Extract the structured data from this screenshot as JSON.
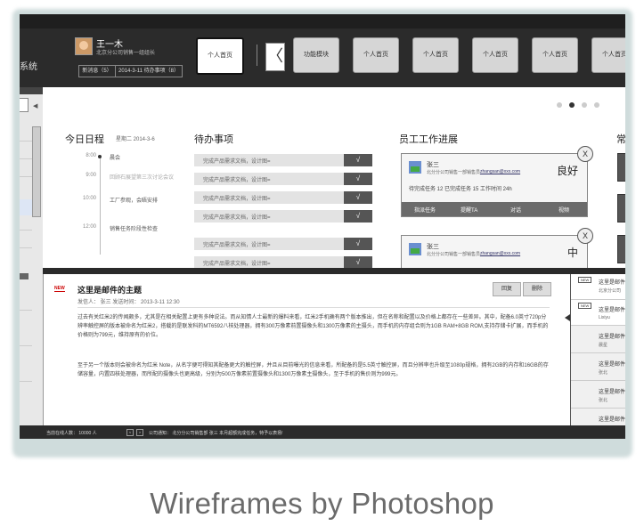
{
  "header": {
    "app_title": "系统",
    "user_name": "王一木",
    "user_dept": "北京分公司销售一组组长",
    "pill_news": "新消息（5）",
    "pill_todo": "2014-3-11 待办事项（8）",
    "tabs": [
      "个人首页",
      "功能模块",
      "个人首页",
      "个人首页",
      "个人首页",
      "个人首页",
      "个人首页"
    ],
    "back_glyph": "〈"
  },
  "dashboard": {
    "schedule_title": "今日日程",
    "schedule_weekday": "星期二  2014-3-6",
    "schedule": [
      {
        "time": "8:00",
        "text": "晨会"
      },
      {
        "time": "9:00",
        "text": "回顾石展望第三次讨论会议"
      },
      {
        "time": "10:00",
        "text": "工厂参观，会晤安排"
      },
      {
        "time": "12:00",
        "text": "销售任务阶段性检查"
      }
    ],
    "todo_title": "待办事项",
    "todos": [
      "完成产品需求文档，设计图=",
      "完成产品需求文档，设计图=",
      "完成产品需求文档，设计图=",
      "完成产品需求文档，设计图=",
      "完成产品需求文档，设计图=",
      "完成产品需求文档，设计图="
    ],
    "check_glyph": "√",
    "progress_title": "员工工作进展",
    "cards": [
      {
        "name": "张三",
        "dept": "北分分公司销售一部销售员",
        "email": "zhangsan@xxx.com",
        "grade": "良好",
        "stats": "待完成任务  12     已完成任务  15     工作时间   24h",
        "buttons": [
          "指派任务",
          "提醒TA",
          "对话",
          "视频"
        ]
      },
      {
        "name": "张三",
        "dept": "北分分公司销售一部销售员",
        "email": "zhangsan@xxx.com",
        "grade": "中"
      }
    ],
    "close_glyph": "X",
    "right_col_title": "常"
  },
  "mail": {
    "new_tag": "NEW",
    "subject": "这里是邮件的主题",
    "meta": "发信人：  张三      发送时间：  2013-3-11   12:30",
    "reply": "回复",
    "delete": "删除",
    "para1": "过去有关红米2的传闻颇多，尤其是在相关配置上更有多种说法。而从知情人士最新的爆料来看，红米2手机确有两个版本推出，但在名称和配置以及价格上都存在一些差异。其中，配备6.0英寸720p分辨率触控屏的版本被命名为红米2，搭载的是联发科的MT6592八核处理器，拥有300万像素前置摄像头和1300万像素的主摄头，而手机的内存组合则为1GB RAM+8GB ROM,支持存储卡扩展，而手机的价格则为799元，维持原有的价位。",
    "para2": "至于另一个版本则会被命名为红米 Note，从名字便可得知其配备更大的触控屏，并且从目前曝光的信息来看，所配备的是5.5英寸触控屏，而且分辨率也升级至1080p规格，拥有2GB的内存和16GB的存储容量，内置四核处理器，而所配的摄像头也更高级，分别为500万像素前置摄像头和1300万像素主摄像头，至于手机的售价则为999元。"
  },
  "mail_list": [
    {
      "tag": "NEW",
      "title": "这里是邮件的",
      "from": "北京分公司"
    },
    {
      "tag": "NEW",
      "title": "这里是邮件的",
      "from": "Lixiyu"
    },
    {
      "tag": "",
      "title": "这里是邮件",
      "from": "晨星"
    },
    {
      "tag": "",
      "title": "这里是邮件",
      "from": "张北"
    },
    {
      "tag": "",
      "title": "这里是邮件",
      "from": "张北"
    },
    {
      "tag": "",
      "title": "这里是邮件",
      "from": ""
    }
  ],
  "status_bar": {
    "online": "当前在线人数：  10000   人",
    "prev": "<",
    "next": ">",
    "notice": "公司通知：  北分分公司销售部 张三 本月超额完成任务，特予以表扬!"
  },
  "caption": "Wireframes by Photoshop"
}
